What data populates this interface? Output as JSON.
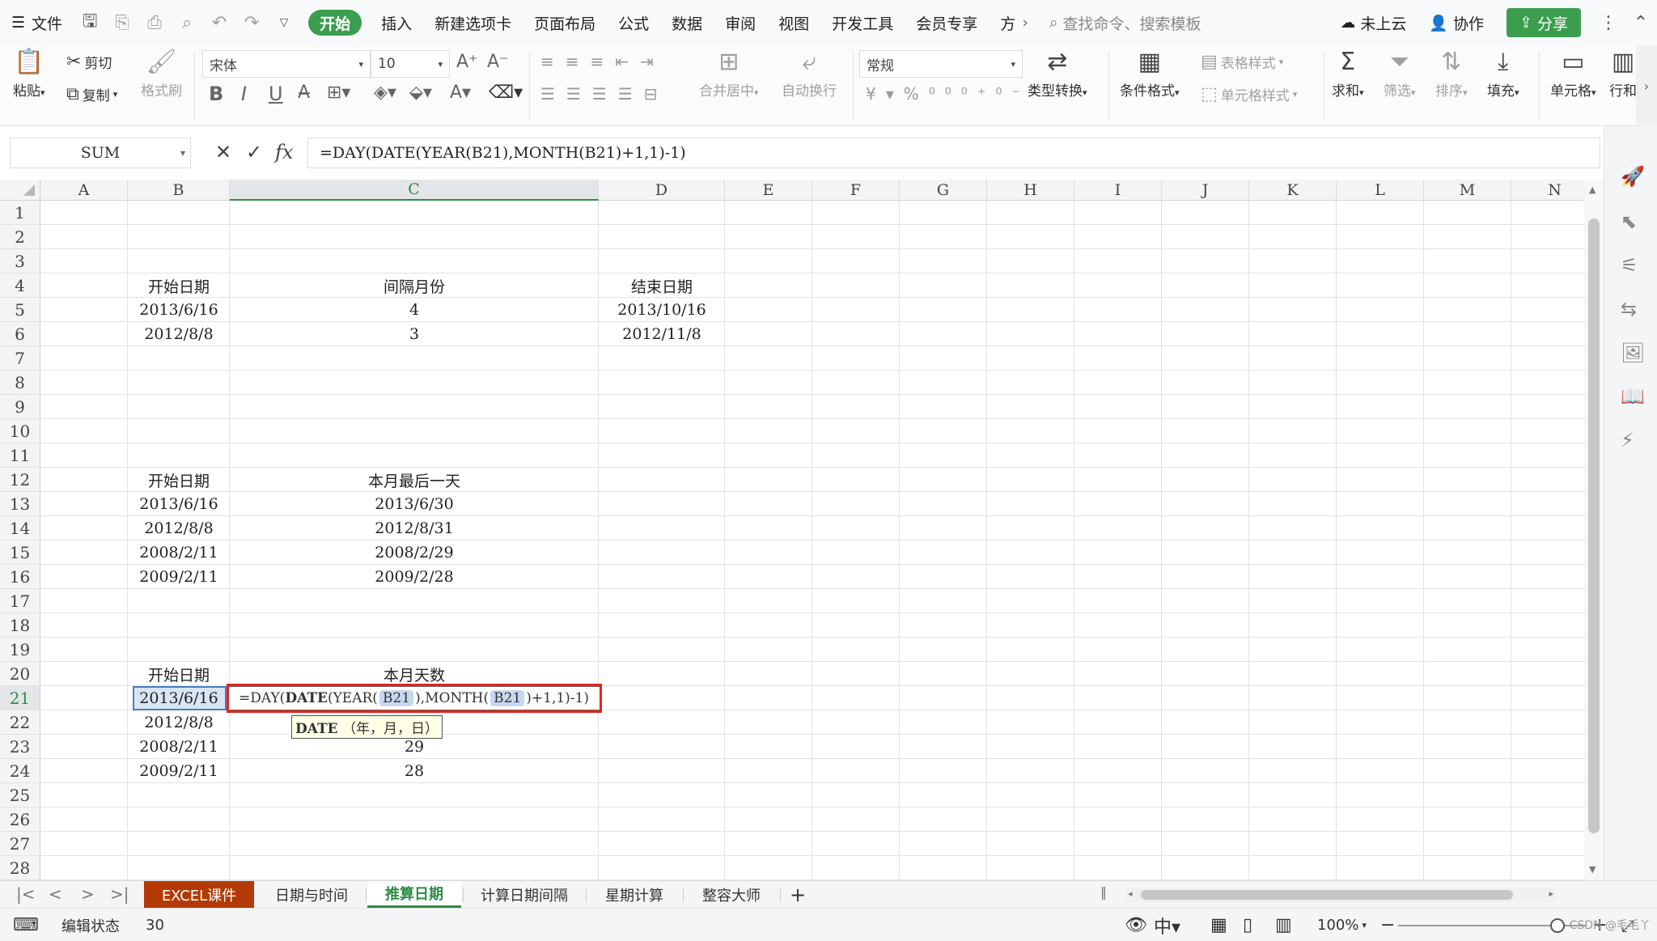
{
  "menu": {
    "file": "文件",
    "tabs": [
      "开始",
      "插入",
      "新建选项卡",
      "页面布局",
      "公式",
      "数据",
      "审阅",
      "视图",
      "开发工具",
      "会员专享",
      "方"
    ],
    "more": "›",
    "search_placeholder": "查找命令、搜索模板",
    "cloud": "未上云",
    "collab": "协作",
    "share": "分享"
  },
  "ribbon": {
    "paste": "粘贴",
    "cut": "剪切",
    "copy": "复制",
    "format_painter": "格式刷",
    "font_name": "宋体",
    "font_size": "10",
    "merge_center": "合并居中",
    "wrap_text": "自动换行",
    "number_format": "常规",
    "type_convert": "类型转换",
    "cond_format": "条件格式",
    "table_style": "表格样式",
    "cell_style": "单元格样式",
    "sum": "求和",
    "filter": "筛选",
    "sort": "排序",
    "fill": "填充",
    "cell": "单元格",
    "row_col": "行和"
  },
  "formula_bar": {
    "name_box": "SUM",
    "formula": "=DAY(DATE(YEAR(B21),MONTH(B21)+1,1)-1)"
  },
  "columns": [
    "A",
    "B",
    "C",
    "D",
    "E",
    "F",
    "G",
    "H",
    "I",
    "J",
    "K",
    "L",
    "M",
    "N"
  ],
  "cells": {
    "b4": "开始日期",
    "c4": "间隔月份",
    "d4": "结束日期",
    "b5": "2013/6/16",
    "c5": "4",
    "d5": "2013/10/16",
    "b6": "2012/8/8",
    "c6": "3",
    "d6": "2012/11/8",
    "b12": "开始日期",
    "c12": "本月最后一天",
    "b13": "2013/6/16",
    "c13": "2013/6/30",
    "b14": "2012/8/8",
    "c14": "2012/8/31",
    "b15": "2008/2/11",
    "c15": "2008/2/29",
    "b16": "2009/2/11",
    "c16": "2009/2/28",
    "b20": "开始日期",
    "c20": "本月天数",
    "b21": "2013/6/16",
    "b22": "2012/8/8",
    "b23": "2008/2/11",
    "c23": "29",
    "b24": "2009/2/11",
    "c24": "28"
  },
  "edit_cell": {
    "p1": "=DAY(",
    "p2": "DATE",
    "p3": "(YEAR(",
    "ref1": "B21",
    "p4": "),MONTH(",
    "ref2": "B21",
    "p5": ")+1,1)-1)"
  },
  "tooltip": {
    "fn": "DATE",
    "args": "（年，月，日）"
  },
  "sheet_tabs": [
    "EXCEL课件",
    "日期与时间",
    "推算日期",
    "计算日期间隔",
    "星期计算",
    "整容大师"
  ],
  "add_sheet": "+",
  "status": {
    "mode": "编辑状态",
    "count": "30",
    "zoom": "100%",
    "zoom_level_percent": 100,
    "watermark": "CSDN @毛毛丫"
  },
  "colors": {
    "accent": "#3b9e4f",
    "highlight_border": "#e3231c",
    "course_tab": "#b33a06"
  }
}
